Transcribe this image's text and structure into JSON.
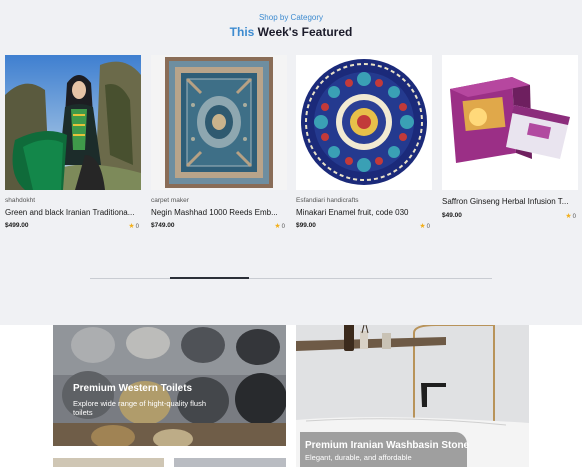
{
  "section": {
    "eyebrow": "Shop by Category",
    "title_accent": "This",
    "title_rest": " Week's Featured"
  },
  "products": [
    {
      "vendor": "shahdokht",
      "title": "Green and black Iranian Traditiona...",
      "price": "$499.00",
      "rating": "0",
      "image": "woman-in-traditional-dress"
    },
    {
      "vendor": "carpet maker",
      "title": "Negin Mashhad 1000 Reeds Emb...",
      "price": "$749.00",
      "rating": "0",
      "image": "persian-carpet"
    },
    {
      "vendor": "Esfandiari handicrafts",
      "title": "Minakari Enamel fruit, code 030",
      "price": "$99.00",
      "rating": "0",
      "image": "enamel-plate"
    },
    {
      "vendor": "",
      "title": "Saffron Ginseng Herbal Infusion T...",
      "price": "$49.00",
      "rating": "0",
      "image": "tea-box"
    }
  ],
  "carousel": {
    "position": 0.2
  },
  "banners": [
    {
      "title": "Premium Western Toilets",
      "subtitle": "Explore wide range of hight-quality flush toilets"
    },
    {
      "title": "Premium Iranian Washbasin Stone",
      "subtitle": "Elegant, durable, and affordable"
    }
  ],
  "colors": {
    "accent": "#3d8bd0",
    "star": "#f2b01e",
    "section_bg": "#f0f1f4"
  }
}
